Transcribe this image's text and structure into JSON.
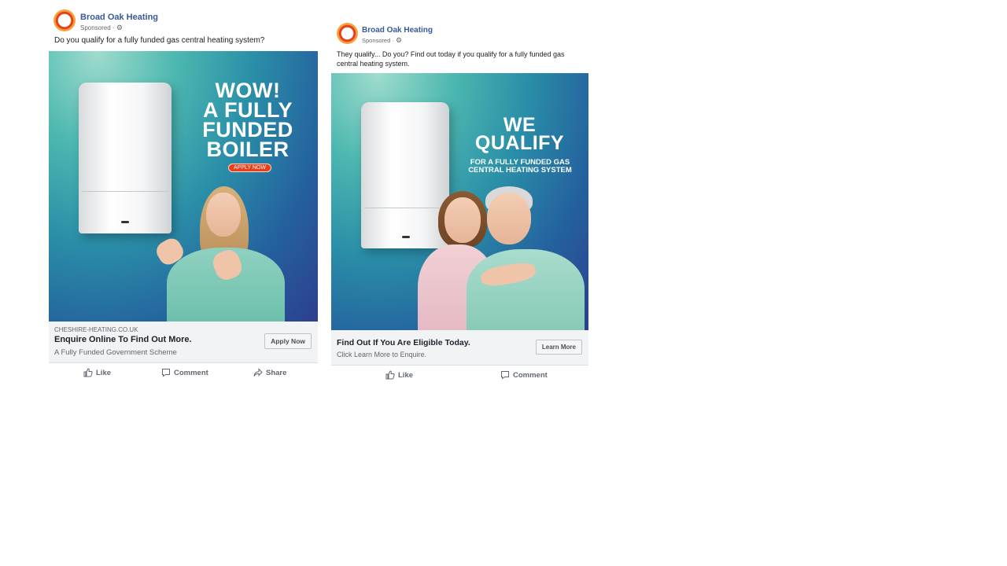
{
  "ads": [
    {
      "page_name": "Broad Oak Heating",
      "sponsored": "Sponsored ·",
      "caption": "Do you qualify for a fully funded gas central heating system?",
      "headline_lines": [
        "WOW!",
        "A FULLY",
        "FUNDED",
        "BOILER"
      ],
      "pill": "APPLY NOW",
      "domain": "CHESHIRE-HEATING.CO.UK",
      "link_title": "Enquire Online To Find Out More.",
      "link_desc": "A Fully Funded Government Scheme",
      "cta": "Apply Now",
      "actions": {
        "like": "Like",
        "comment": "Comment",
        "share": "Share"
      }
    },
    {
      "page_name": "Broad Oak Heating",
      "sponsored": "Sponsored ·",
      "caption": "They qualify... Do you? Find out today if you qualify for a fully funded gas central heating system.",
      "headline_lines": [
        "WE",
        "QUALIFY"
      ],
      "subline": "FOR A FULLY FUNDED GAS CENTRAL HEATING SYSTEM",
      "link_title": "Find Out If You Are Eligible Today.",
      "link_desc": "Click Learn More to Enquire.",
      "cta": "Learn More",
      "actions": {
        "like": "Like",
        "comment": "Comment"
      }
    }
  ],
  "colors": {
    "brand_blue": "#385898",
    "accent_orange": "#e8401c",
    "teal": "#4db8b0",
    "navy": "#2d3f8e"
  },
  "icons": [
    "settings-gear-icon",
    "thumbs-up-icon",
    "comment-bubble-icon",
    "share-arrow-icon"
  ]
}
